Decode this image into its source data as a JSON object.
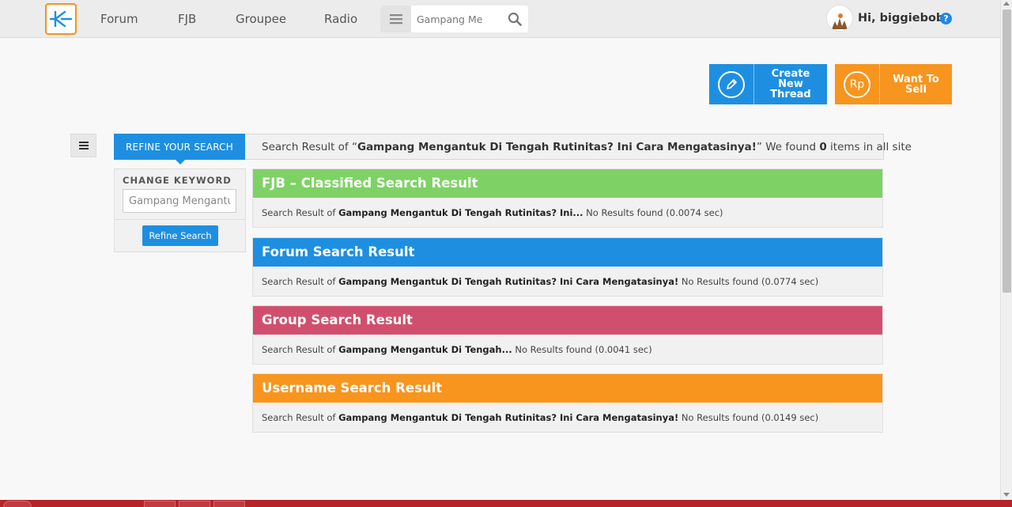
{
  "nav": {
    "links": [
      "Forum",
      "FJB",
      "Groupee",
      "Radio"
    ],
    "search_value": "Gampang Me",
    "greeting": "Hi, biggiebobo",
    "help_glyph": "?"
  },
  "actions": {
    "create_label": "Create New Thread",
    "sell_label": "Want To Sell",
    "sell_icon_text": "Rp"
  },
  "result_bar": {
    "refine_tab": "REFINE YOUR SEARCH",
    "prefix": "Search Result of “",
    "query": "Gampang Mengantuk Di Tengah Rutinitas? Ini Cara Mengatasinya!",
    "middle": "” We found ",
    "count": "0",
    "suffix": " items in all site"
  },
  "sidebar": {
    "label": "CHANGE KEYWORD",
    "keyword_value": "Gampang Mengantuk",
    "button": "Refine Search"
  },
  "sections": [
    {
      "title": "FJB – Classified Search Result",
      "color": "#7ed265",
      "prefix": "Search Result of ",
      "query": "Gampang Mengantuk Di Tengah Rutinitas? Ini...",
      "status": " No Results found (0.0074 sec)"
    },
    {
      "title": "Forum Search Result",
      "color": "#1e8fe0",
      "prefix": "Search Result of ",
      "query": "Gampang Mengantuk Di Tengah Rutinitas? Ini Cara Mengatasinya!",
      "status": " No Results found (0.0774 sec)"
    },
    {
      "title": "Group Search Result",
      "color": "#d14f6e",
      "prefix": "Search Result of ",
      "query": "Gampang Mengantuk Di Tengah...",
      "status": " No Results found (0.0041 sec)"
    },
    {
      "title": "Username Search Result",
      "color": "#f7951e",
      "prefix": "Search Result of ",
      "query": "Gampang Mengantuk Di Tengah Rutinitas? Ini Cara Mengatasinya!",
      "status": " No Results found (0.0149 sec)"
    }
  ],
  "icons": [
    "kaskus-logo-icon",
    "menu-icon",
    "search-icon",
    "avatar",
    "help-icon",
    "pencil-icon",
    "rupiah-icon",
    "list-toggle-icon"
  ]
}
